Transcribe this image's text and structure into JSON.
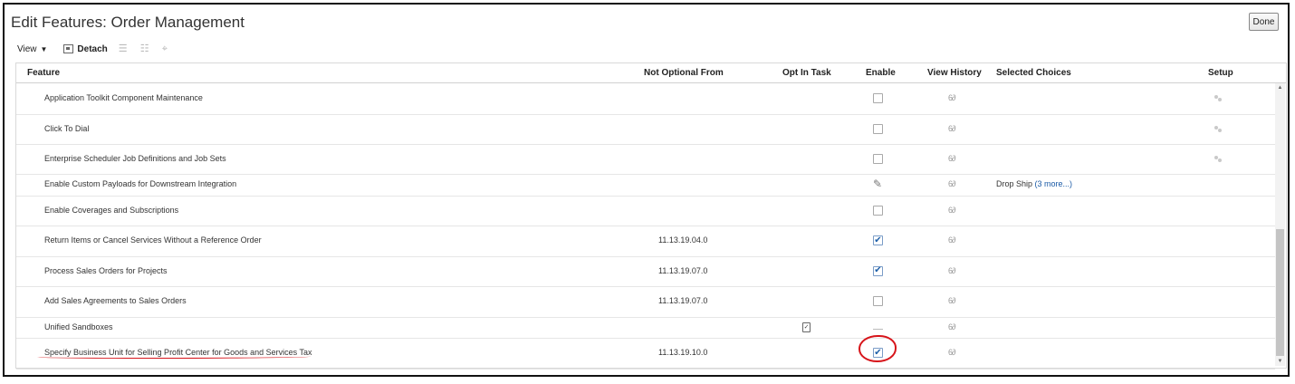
{
  "page": {
    "title": "Edit Features: Order Management",
    "done_label": "Done"
  },
  "toolbar": {
    "view_label": "View",
    "detach_label": "Detach"
  },
  "columns": {
    "feature": "Feature",
    "not_optional_from": "Not Optional From",
    "opt_in_task": "Opt In Task",
    "enable": "Enable",
    "view_history": "View History",
    "selected_choices": "Selected Choices",
    "setup": "Setup"
  },
  "history_icon_glyph": "6∂",
  "rows": [
    {
      "feature": "Application Toolkit Component Maintenance",
      "not_optional_from": "",
      "enable": "unchecked",
      "setup_icon": true
    },
    {
      "feature": "Click To Dial",
      "not_optional_from": "",
      "enable": "unchecked",
      "setup_icon": true
    },
    {
      "feature": "Enterprise Scheduler Job Definitions and Job Sets",
      "not_optional_from": "",
      "enable": "unchecked",
      "setup_icon": true
    },
    {
      "feature": "Enable Custom Payloads for Downstream Integration",
      "not_optional_from": "",
      "enable": "edit",
      "selected_choices": "Drop Ship",
      "selected_more": "(3 more...)"
    },
    {
      "feature": "Enable Coverages and Subscriptions",
      "not_optional_from": "",
      "enable": "unchecked"
    },
    {
      "feature": "Return Items or Cancel Services Without a Reference Order",
      "not_optional_from": "11.13.19.04.0",
      "enable": "checked"
    },
    {
      "feature": "Process Sales Orders for Projects",
      "not_optional_from": "11.13.19.07.0",
      "enable": "checked"
    },
    {
      "feature": "Add Sales Agreements to Sales Orders",
      "not_optional_from": "11.13.19.07.0",
      "enable": "unchecked"
    },
    {
      "feature": "Unified Sandboxes",
      "not_optional_from": "",
      "opt_in_task": true,
      "enable": "none"
    },
    {
      "feature": "Specify Business Unit for Selling Profit Center for Goods and Services Tax",
      "not_optional_from": "11.13.19.10.0",
      "enable": "checked"
    }
  ],
  "colors": {
    "annotation_red": "#d7141a",
    "link_blue": "#1a5aa6",
    "check_blue": "#1e5fa8"
  }
}
